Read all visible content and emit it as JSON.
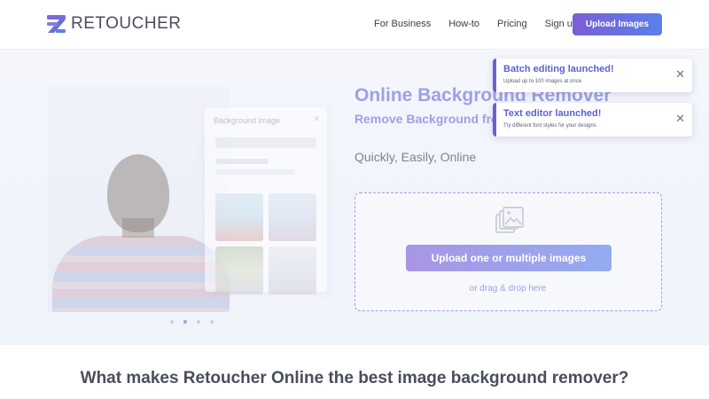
{
  "brand": {
    "name": "RETOUCHER",
    "accent": "#6a6ed8",
    "gradient_start": "#7b5ed6",
    "gradient_end": "#5c7fe9"
  },
  "nav": {
    "items": [
      "For Business",
      "How-to",
      "Pricing",
      "Sign up"
    ],
    "upload_label": "Upload Images"
  },
  "hero": {
    "title": "Online Background Remover",
    "subtitle": "Remove Background from",
    "tagline": "Quickly, Easily, Online",
    "upload_button": "Upload one or multiple images",
    "drag_text": "or drag & drop here",
    "upload_icon": "images-stack-icon",
    "carousel_dots": 4,
    "carousel_active_index": 1,
    "mockup_panel_title": "Background image"
  },
  "toasts": [
    {
      "title": "Batch editing launched!",
      "subtitle": "Upload up to 100 images at once",
      "close_icon": "close-icon"
    },
    {
      "title": "Text editor launched!",
      "subtitle": "Try different font styles for your designs",
      "close_icon": "close-icon"
    }
  ],
  "section": {
    "title": "What makes Retoucher Online the best image background remover?"
  }
}
